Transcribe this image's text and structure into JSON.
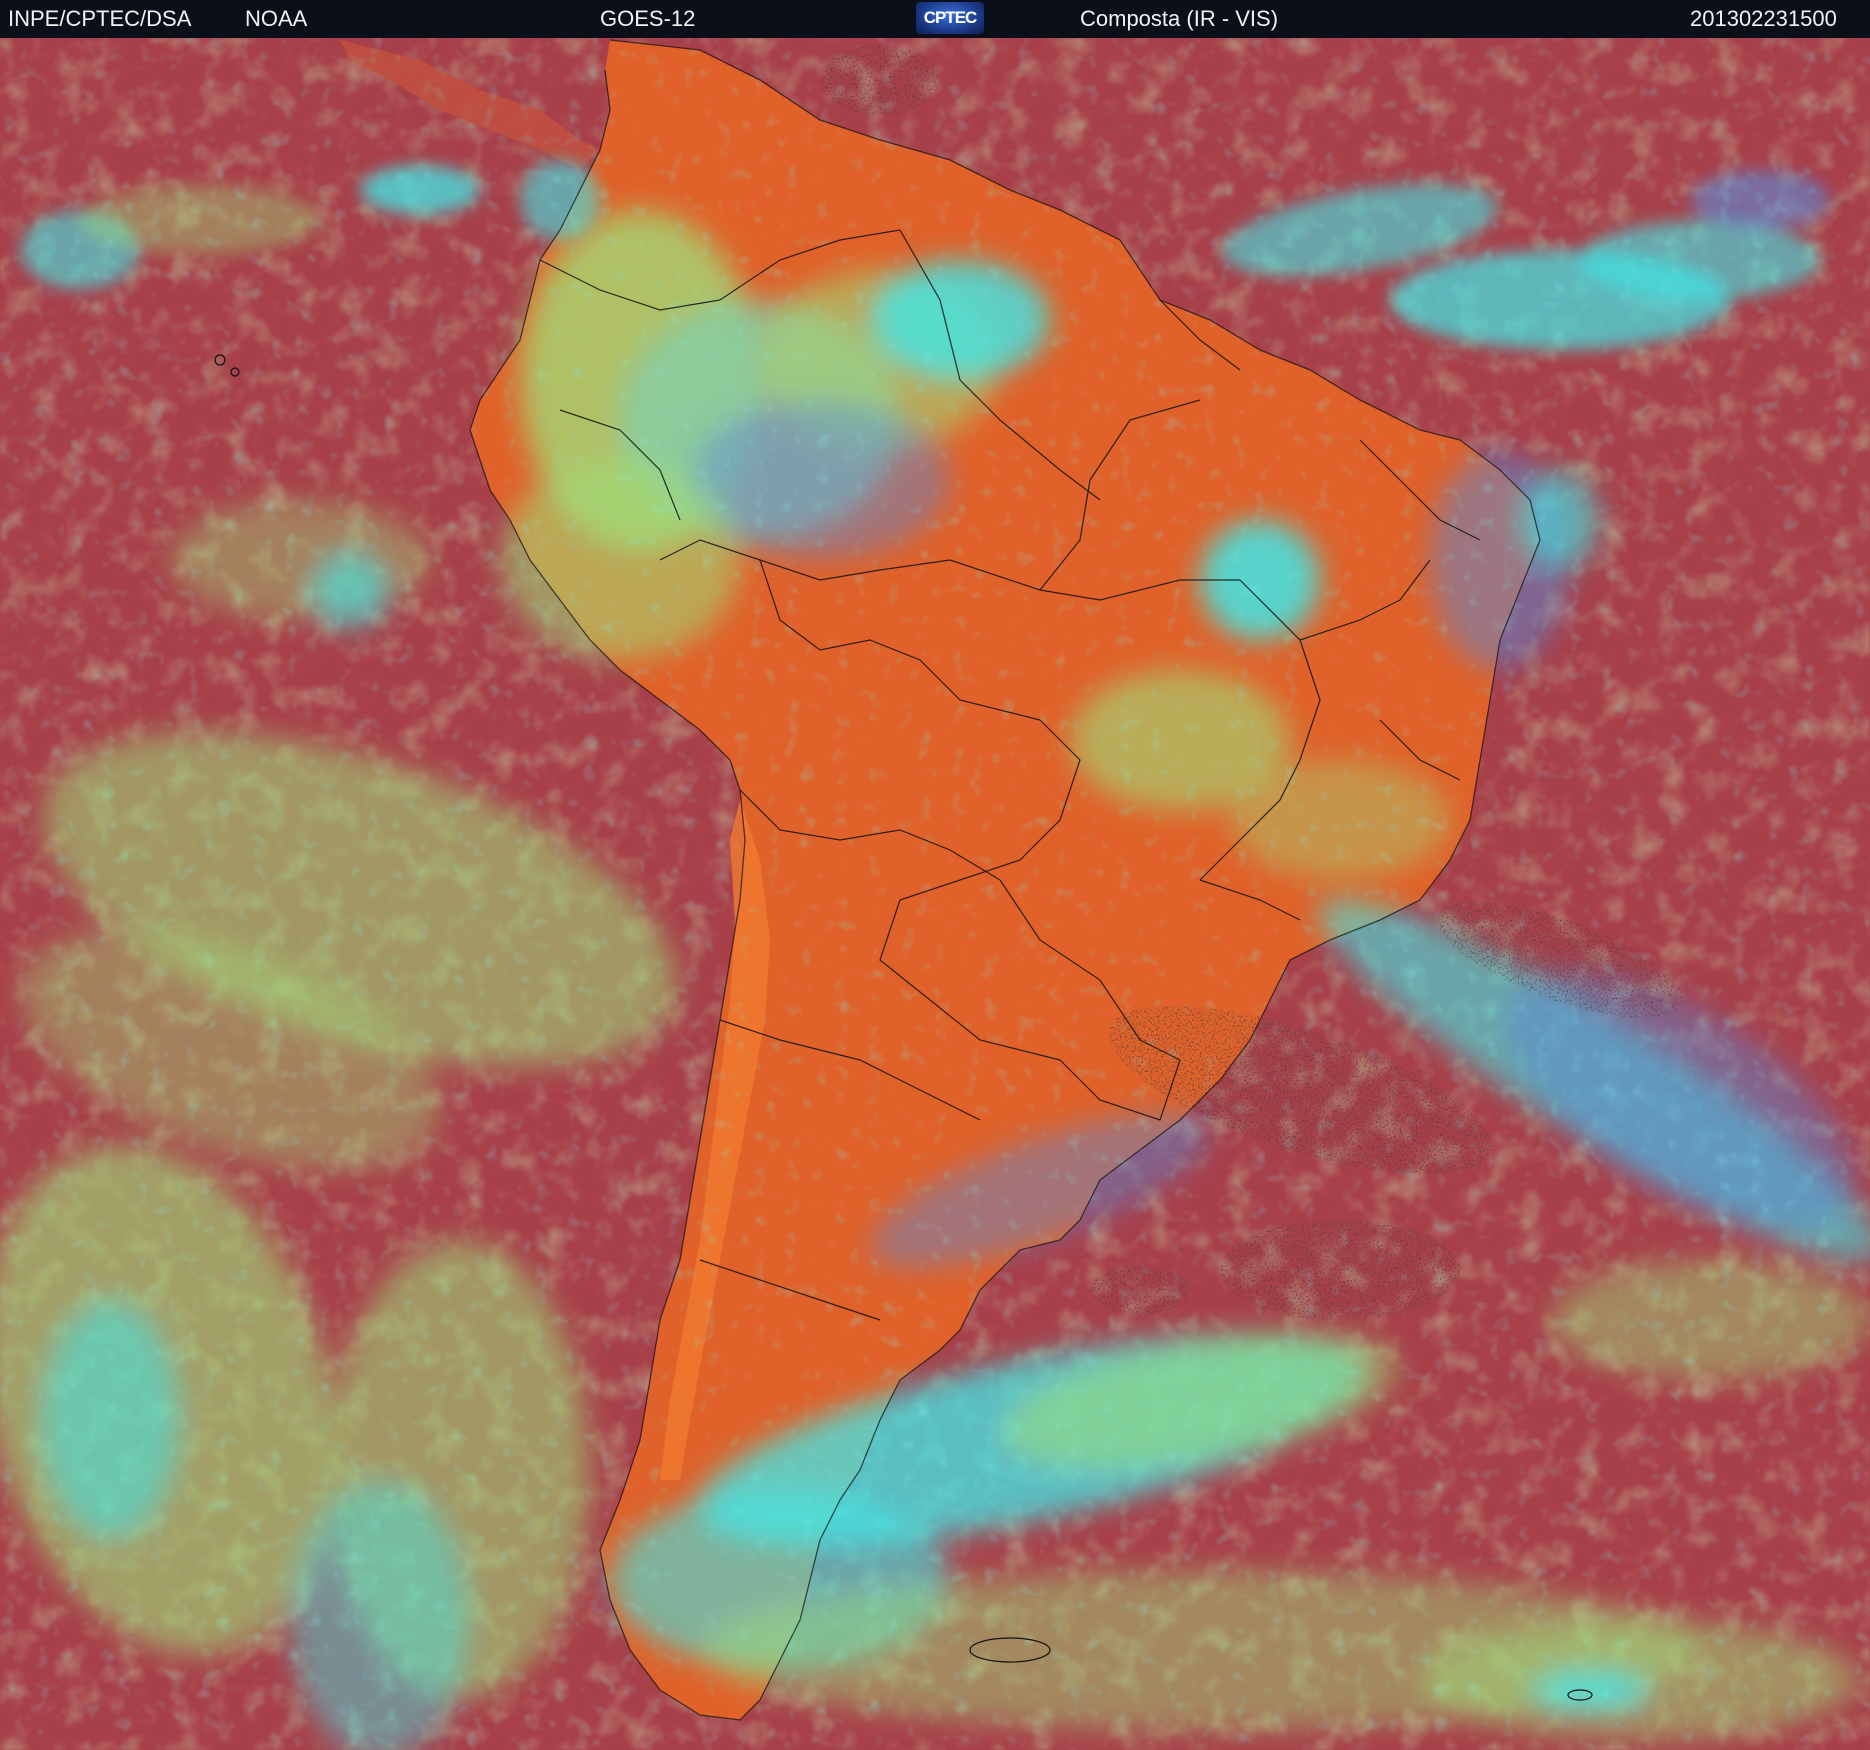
{
  "header": {
    "agency": "INPE/CPTEC/DSA",
    "partner": "NOAA",
    "satellite": "GOES-12",
    "logo_text": "CPTEC",
    "product": "Composta (IR - VIS)",
    "timestamp": "201302231500"
  },
  "colors": {
    "ocean_clear": "#a8404a",
    "land_clear": "#e0622a",
    "low_cloud": "#9fe07a",
    "high_cloud": "#40e8e8",
    "mid_cloud": "#5a8ad8",
    "cold_speckle": "#1a1010",
    "borders": "#101010",
    "header_bg": "#0a0f1a"
  }
}
